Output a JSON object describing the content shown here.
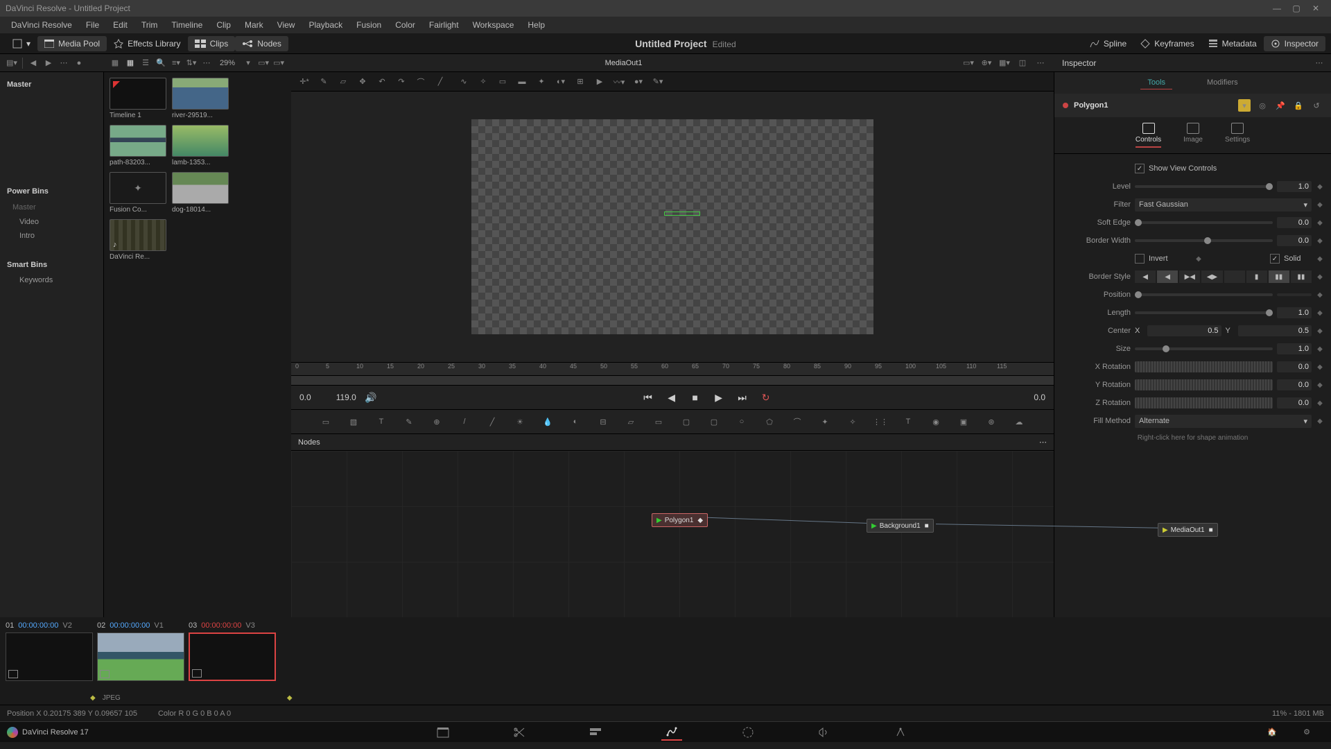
{
  "titlebar": {
    "text": "DaVinci Resolve - Untitled Project"
  },
  "menubar": {
    "items": [
      "DaVinci Resolve",
      "File",
      "Edit",
      "Trim",
      "Timeline",
      "Clip",
      "Mark",
      "View",
      "Playback",
      "Fusion",
      "Color",
      "Fairlight",
      "Workspace",
      "Help"
    ]
  },
  "toolbar": {
    "mediaPool": "Media Pool",
    "effectsLibrary": "Effects Library",
    "clips": "Clips",
    "nodes": "Nodes",
    "projectTitle": "Untitled Project",
    "edited": "Edited",
    "spline": "Spline",
    "keyframes": "Keyframes",
    "metadata": "Metadata",
    "inspector": "Inspector"
  },
  "subbar": {
    "zoom": "29%",
    "viewerLabel": "MediaOut1",
    "inspectorLabel": "Inspector"
  },
  "bins": {
    "master": "Master",
    "powerBins": "Power Bins",
    "masterSub": "Master",
    "video": "Video",
    "intro": "Intro",
    "smartBins": "Smart Bins",
    "keywords": "Keywords"
  },
  "thumbs": [
    {
      "name": "Timeline 1",
      "cls": "timeline"
    },
    {
      "name": "river-29519...",
      "cls": "river"
    },
    {
      "name": "path-83203...",
      "cls": "path"
    },
    {
      "name": "lamb-1353...",
      "cls": "lamb"
    },
    {
      "name": "Fusion Co...",
      "cls": "comp",
      "glyph": "✦"
    },
    {
      "name": "dog-18014...",
      "cls": "dog"
    },
    {
      "name": "DaVinci Re...",
      "cls": "davinci"
    }
  ],
  "ruler": {
    "ticks": [
      "0",
      "5",
      "10",
      "15",
      "20",
      "25",
      "30",
      "35",
      "40",
      "45",
      "50",
      "55",
      "60",
      "65",
      "70",
      "75",
      "80",
      "85",
      "90",
      "95",
      "100",
      "105",
      "110",
      "115"
    ]
  },
  "transport": {
    "tcLeft": "0.0",
    "dur": "119.0",
    "tcRight": "0.0"
  },
  "nodesPanel": {
    "title": "Nodes"
  },
  "nodes": {
    "polygon": "Polygon1",
    "background": "Background1",
    "mediaout": "MediaOut1"
  },
  "clips": [
    {
      "n": "01",
      "tc": "00:00:00:00",
      "trk": "V2",
      "sel": false,
      "img": ""
    },
    {
      "n": "02",
      "tc": "00:00:00:00",
      "trk": "V1",
      "sel": false,
      "img": "path"
    },
    {
      "n": "03",
      "tc": "00:00:00:00",
      "trk": "V3",
      "sel": true,
      "img": ""
    }
  ],
  "jpegLabel": "JPEG",
  "status": {
    "pos": "Position X 0.20175    389       Y 0.09657      105",
    "color": "Color R 0            G 0            B 0            A 0",
    "right": "11% - 1801 MB"
  },
  "appLabel": "DaVinci Resolve 17",
  "inspector": {
    "tabs": {
      "tools": "Tools",
      "modifiers": "Modifiers"
    },
    "nodeName": "Polygon1",
    "subtabs": {
      "controls": "Controls",
      "image": "Image",
      "settings": "Settings"
    },
    "showViewControls": "Show View Controls",
    "rows": {
      "level": {
        "label": "Level",
        "value": "1.0"
      },
      "filter": {
        "label": "Filter",
        "value": "Fast Gaussian"
      },
      "softEdge": {
        "label": "Soft Edge",
        "value": "0.0"
      },
      "borderWidth": {
        "label": "Border Width",
        "value": "0.0"
      },
      "invert": {
        "label": "Invert",
        "solid": "Solid"
      },
      "borderStyle": {
        "label": "Border Style"
      },
      "position": {
        "label": "Position"
      },
      "length": {
        "label": "Length",
        "value": "1.0"
      },
      "center": {
        "label": "Center",
        "x": "X",
        "xv": "0.5",
        "y": "Y",
        "yv": "0.5"
      },
      "size": {
        "label": "Size",
        "value": "1.0"
      },
      "xrot": {
        "label": "X Rotation",
        "value": "0.0"
      },
      "yrot": {
        "label": "Y Rotation",
        "value": "0.0"
      },
      "zrot": {
        "label": "Z Rotation",
        "value": "0.0"
      },
      "fillMethod": {
        "label": "Fill Method",
        "value": "Alternate"
      }
    },
    "hint": "Right-click here for shape animation"
  }
}
